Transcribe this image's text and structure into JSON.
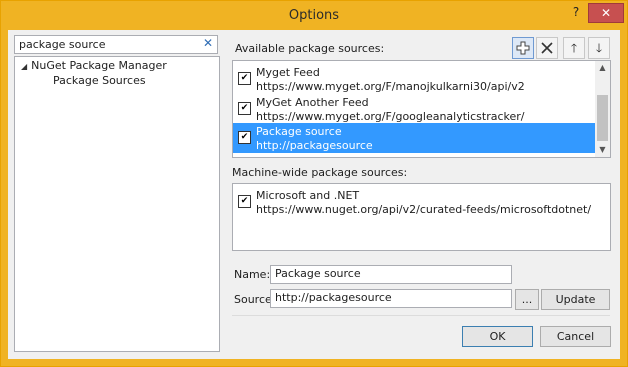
{
  "window": {
    "title": "Options",
    "help_label": "?",
    "close_label": "✕"
  },
  "search": {
    "value": "package source",
    "clear_label": "✕"
  },
  "tree": {
    "parent_label": "NuGet Package Manager",
    "child_label": "Package Sources"
  },
  "available": {
    "label": "Available package sources:",
    "items": [
      {
        "name": "Myget Feed",
        "url": "https://www.myget.org/F/manojkulkarni30/api/v2",
        "checked": true
      },
      {
        "name": "MyGet Another Feed",
        "url": "https://www.myget.org/F/googleanalyticstracker/",
        "checked": true
      },
      {
        "name": "Package source",
        "url": "http://packagesource",
        "checked": true,
        "selected": true
      }
    ]
  },
  "toolbar": {
    "add_icon": "plus-icon",
    "remove_icon": "x-icon",
    "up_icon": "arrow-up-icon",
    "down_icon": "arrow-down-icon"
  },
  "machine_wide": {
    "label": "Machine-wide package sources:",
    "items": [
      {
        "name": "Microsoft and .NET",
        "url": "https://www.nuget.org/api/v2/curated-feeds/microsoftdotnet/",
        "checked": true
      }
    ]
  },
  "form": {
    "name_label": "Name:",
    "name_value": "Package source",
    "source_label": "Source:",
    "source_value": "http://packagesource",
    "browse_label": "...",
    "update_label": "Update"
  },
  "footer": {
    "ok_label": "OK",
    "cancel_label": "Cancel"
  },
  "colors": {
    "title_bar": "#f0b323",
    "selection": "#3399ff",
    "close_button": "#c75050"
  }
}
